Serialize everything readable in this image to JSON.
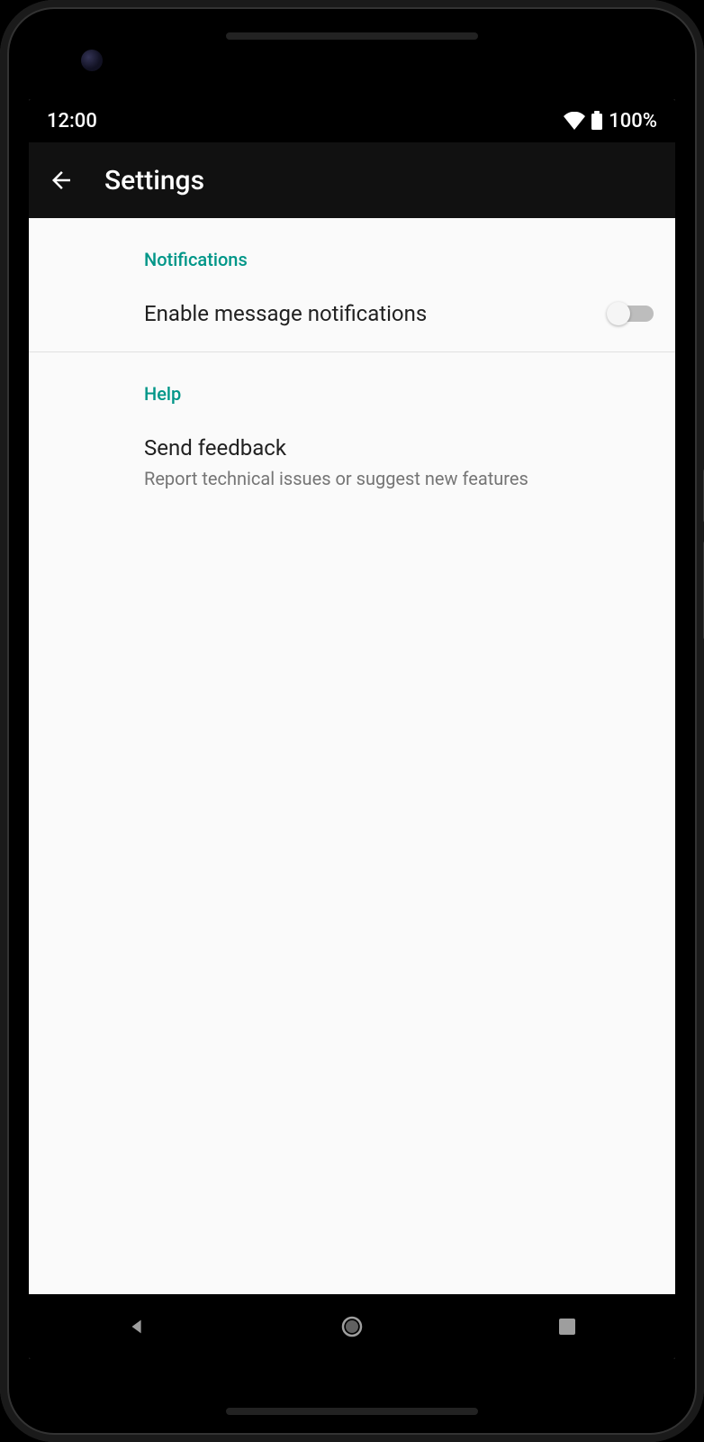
{
  "statusbar": {
    "time": "12:00",
    "battery_pct": "100%"
  },
  "appbar": {
    "title": "Settings"
  },
  "sections": {
    "notifications": {
      "header": "Notifications",
      "enable_label": "Enable message notifications",
      "enable_state": false
    },
    "help": {
      "header": "Help",
      "feedback_title": "Send feedback",
      "feedback_sub": "Report technical issues or suggest new features"
    }
  }
}
